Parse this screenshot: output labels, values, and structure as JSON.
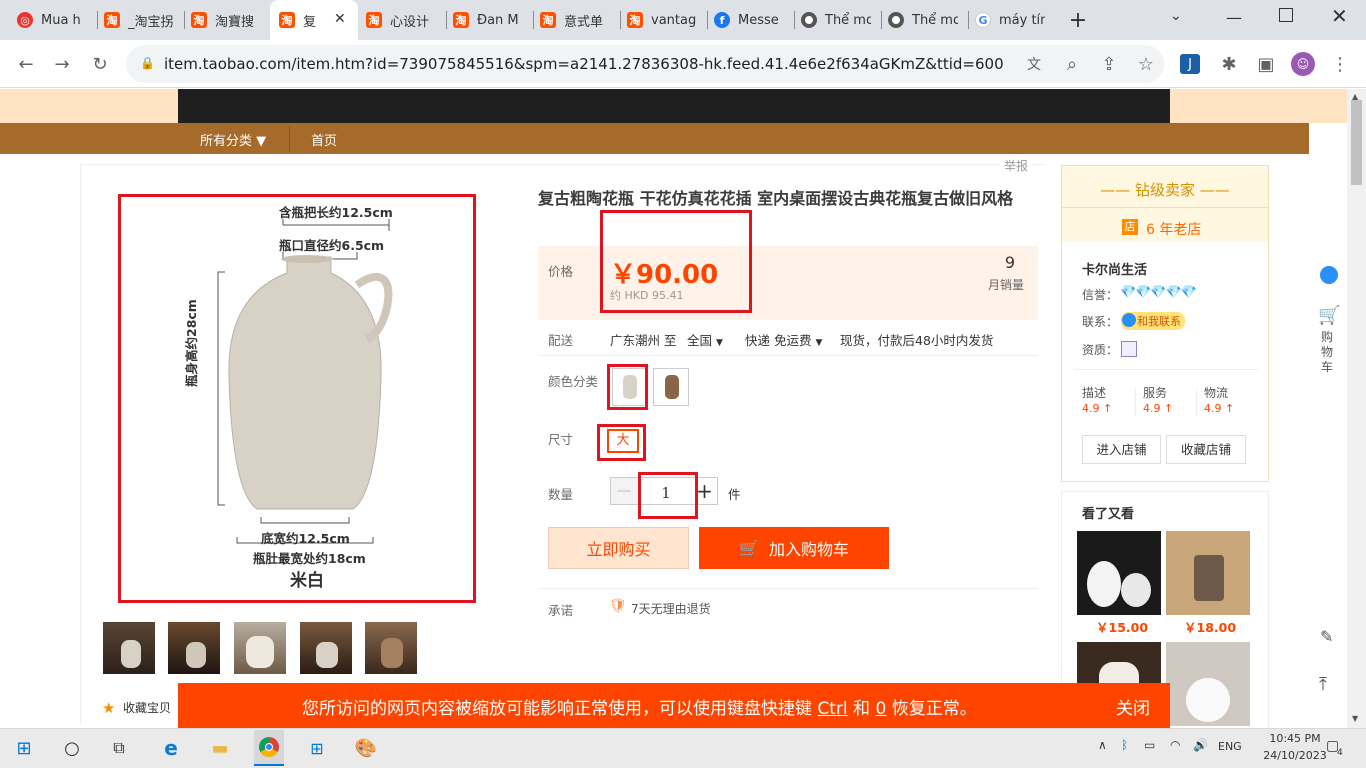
{
  "browser": {
    "tabs": [
      {
        "label": "Mua h",
        "icon": "muahang-icon"
      },
      {
        "label": "_淘宝拐",
        "icon": "taobao-icon"
      },
      {
        "label": "淘寶搜",
        "icon": "taobao-icon"
      },
      {
        "label": "复",
        "icon": "taobao-icon",
        "active": true
      },
      {
        "label": "心设计",
        "icon": "taobao-icon"
      },
      {
        "label": "Đan M",
        "icon": "taobao-icon"
      },
      {
        "label": "意式单",
        "icon": "taobao-icon"
      },
      {
        "label": "vantag",
        "icon": "taobao-icon"
      },
      {
        "label": "Messe",
        "icon": "facebook-icon"
      },
      {
        "label": "Thể mo",
        "icon": "chrome-icon"
      },
      {
        "label": "Thể mo",
        "icon": "chrome-icon"
      },
      {
        "label": "máy tín",
        "icon": "google-icon"
      }
    ],
    "taobao_glyph": "淘",
    "url": "item.taobao.com/item.htm?id=739075845516&spm=a2141.27836308-hk.feed.41.4e6e2f634aGKmZ&ttid=600000..."
  },
  "nav": {
    "all_categories": "所有分类 ▼",
    "home": "首页",
    "report": "举报"
  },
  "gallery": {
    "dim_handle": "含瓶把长约12.5cm",
    "dim_mouth": "瓶口直径约6.5cm",
    "dim_height": "瓶身高约28cm",
    "dim_base": "底宽约12.5cm",
    "dim_belly": "瓶肚最宽处约18cm",
    "color_name": "米白",
    "favorite": "收藏宝贝"
  },
  "product": {
    "title": "复古粗陶花瓶 干花仿真花花插 室内桌面摆设古典花瓶复古做旧风格",
    "price_label": "价格",
    "price": "￥90.00",
    "hkd": "约 HKD 95.41",
    "sold_count": "9",
    "sold_label": "月销量",
    "delivery_label": "配送",
    "delivery_from": "广东潮州 至",
    "delivery_to": "全国",
    "shipping": "快递 免运费",
    "stock_note": "现货，付款后48小时内发货",
    "color_label": "颜色分类",
    "size_label": "尺寸",
    "size_option": "大",
    "qty_label": "数量",
    "qty_value": "1",
    "qty_unit": "件",
    "buy_now": "立即购买",
    "add_cart": "加入购物车",
    "promise_label": "承诺",
    "promise": "7天无理由退货"
  },
  "seller": {
    "level": "钻级卖家",
    "years": "6 年老店",
    "shop_name": "卡尔尚生活",
    "credit_label": "信誉：",
    "contact_label": "联系：",
    "contact_btn": "和我联系",
    "qual_label": "资质：",
    "ratings": [
      {
        "name": "描述",
        "score": "4.9 ↑"
      },
      {
        "name": "服务",
        "score": "4.9 ↑"
      },
      {
        "name": "物流",
        "score": "4.9 ↑"
      }
    ],
    "enter_shop": "进入店铺",
    "fav_shop": "收藏店铺"
  },
  "recommend": {
    "title": "看了又看",
    "prices": [
      "￥15.00",
      "￥18.00"
    ]
  },
  "rail": {
    "cart": "购\n物\n车"
  },
  "banner": {
    "text_a": "您所访问的网页内容被缩放可能影响正常使用，可以使用键盘快捷键 ",
    "key1": "Ctrl",
    "text_b": " 和 ",
    "key2": "0",
    "text_c": " 恢复正常。",
    "close": "关闭"
  },
  "taskbar": {
    "lang": "ENG",
    "time": "10:45 PM",
    "date": "24/10/2023",
    "notifications": "4"
  },
  "colors": {
    "accent": "#ff4400",
    "brown": "#a66a2b",
    "highlight": "#e0141e"
  }
}
